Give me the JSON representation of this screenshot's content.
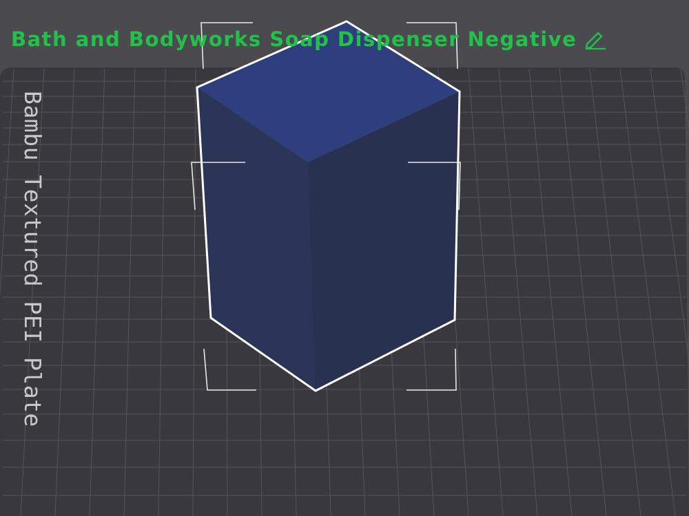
{
  "model": {
    "name": "Bath and Bodyworks Soap Dispenser Negative",
    "edit_icon": "pencil-icon"
  },
  "plate": {
    "label": "Bambu Textured PEI Plate"
  },
  "colors": {
    "background": "#4a4a4f",
    "plate": "#38383e",
    "grid": "#55555b",
    "title_text": "#22c14a",
    "object_top": "#2f3f7e",
    "object_left": "#2b3557",
    "object_right": "#28314f",
    "selection_outline": "#ffffff"
  }
}
